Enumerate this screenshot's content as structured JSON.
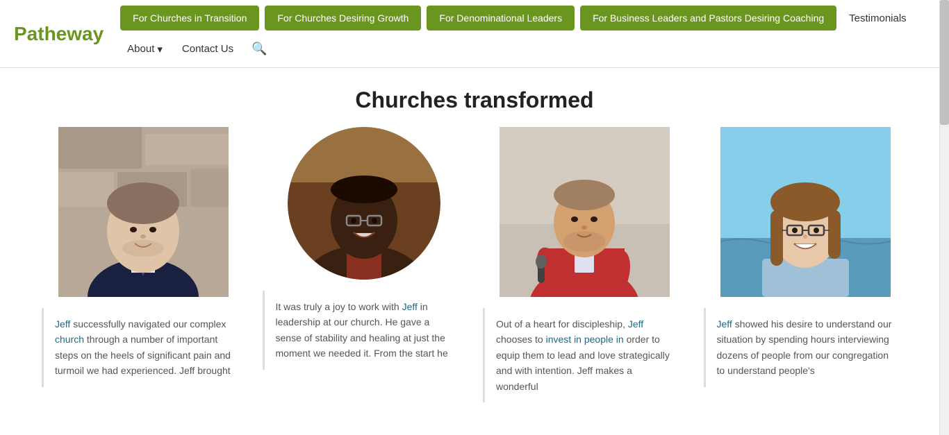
{
  "logo": {
    "text": "Patheway"
  },
  "nav": {
    "btn1": "For Churches in Transition",
    "btn2": "For Churches Desiring Growth",
    "btn3": "For Denominational Leaders",
    "btn4": "For Business Leaders and Pastors Desiring Coaching",
    "link1": "Testimonials",
    "link2": "About",
    "link3": "Contact Us"
  },
  "page": {
    "title": "Churches transformed"
  },
  "testimonials": [
    {
      "id": 1,
      "text_parts": [
        {
          "text": "Jeff",
          "highlight": true
        },
        {
          "text": " successfully navigated our complex ",
          "highlight": false
        },
        {
          "text": "church",
          "highlight": true
        },
        {
          "text": " through a number of important steps on the heels of significant pain and turmoil we had experienced. Jeff brought",
          "highlight": false
        }
      ]
    },
    {
      "id": 2,
      "text_parts": [
        {
          "text": "It was truly a joy to work with ",
          "highlight": false
        },
        {
          "text": "Jeff",
          "highlight": true
        },
        {
          "text": " in leadership at our church. He gave a sense of stability and healing at just the moment we needed it. From the start he",
          "highlight": false
        }
      ]
    },
    {
      "id": 3,
      "text_parts": [
        {
          "text": "Out of a heart for discipleship, ",
          "highlight": false
        },
        {
          "text": "Jeff",
          "highlight": true
        },
        {
          "text": " chooses to ",
          "highlight": false
        },
        {
          "text": "invest in people in",
          "highlight": true
        },
        {
          "text": " order to equip them to lead and love strategically and with intention.  Jeff makes a wonderful",
          "highlight": false
        }
      ]
    },
    {
      "id": 4,
      "text_parts": [
        {
          "text": "Jeff",
          "highlight": true
        },
        {
          "text": " showed his desire to understand our situation by spending hours interviewing dozens of people from our congregation to understand people's",
          "highlight": false
        }
      ]
    }
  ]
}
